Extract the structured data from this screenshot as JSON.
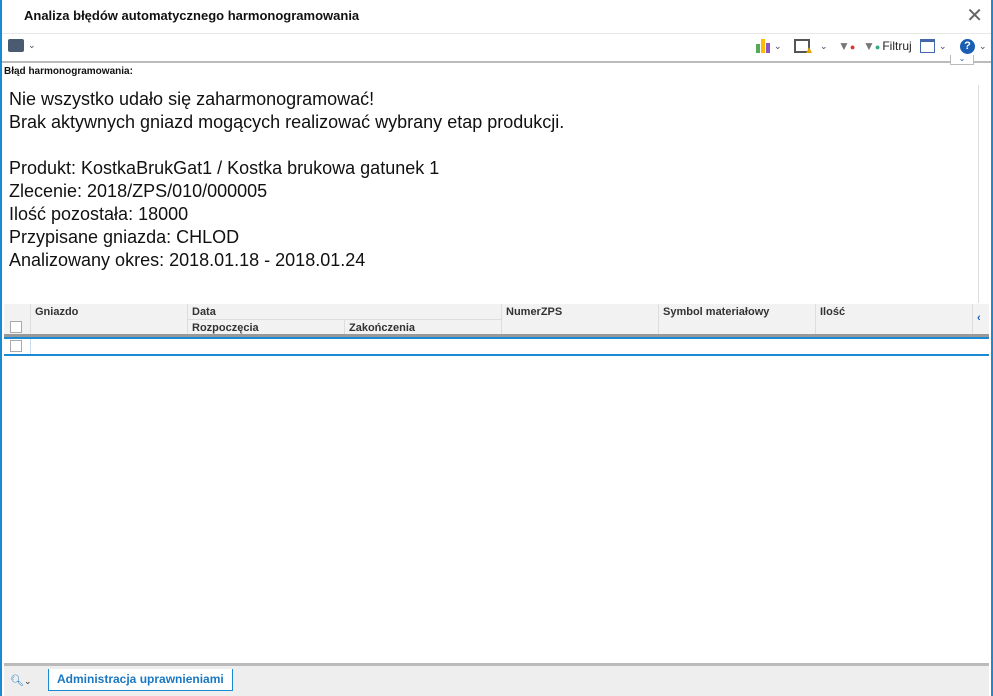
{
  "window": {
    "title": "Analiza błędów automatycznego harmonogramowania"
  },
  "toolbar": {
    "filter_label": "Filtruj"
  },
  "error": {
    "label": "Błąd harmonogramowania:",
    "lines": [
      "Nie wszystko udało się zaharmonogramować!",
      "Brak aktywnych gniazd mogących realizować wybrany etap produkcji.",
      "",
      "Produkt: KostkaBrukGat1 / Kostka brukowa gatunek 1",
      "Zlecenie: 2018/ZPS/010/000005",
      "Ilość pozostała: 18000",
      "Przypisane gniazda: CHLOD",
      "Analizowany okres: 2018.01.18 - 2018.01.24"
    ]
  },
  "grid": {
    "columns": {
      "gniazdo": "Gniazdo",
      "data": "Data",
      "start": "Rozpoczęcia",
      "end": "Zakończenia",
      "numer": "NumerZPS",
      "symbol": "Symbol materiałowy",
      "ilosc": "Ilość"
    }
  },
  "bottom": {
    "admin_label": "Administracja uprawnieniami"
  }
}
